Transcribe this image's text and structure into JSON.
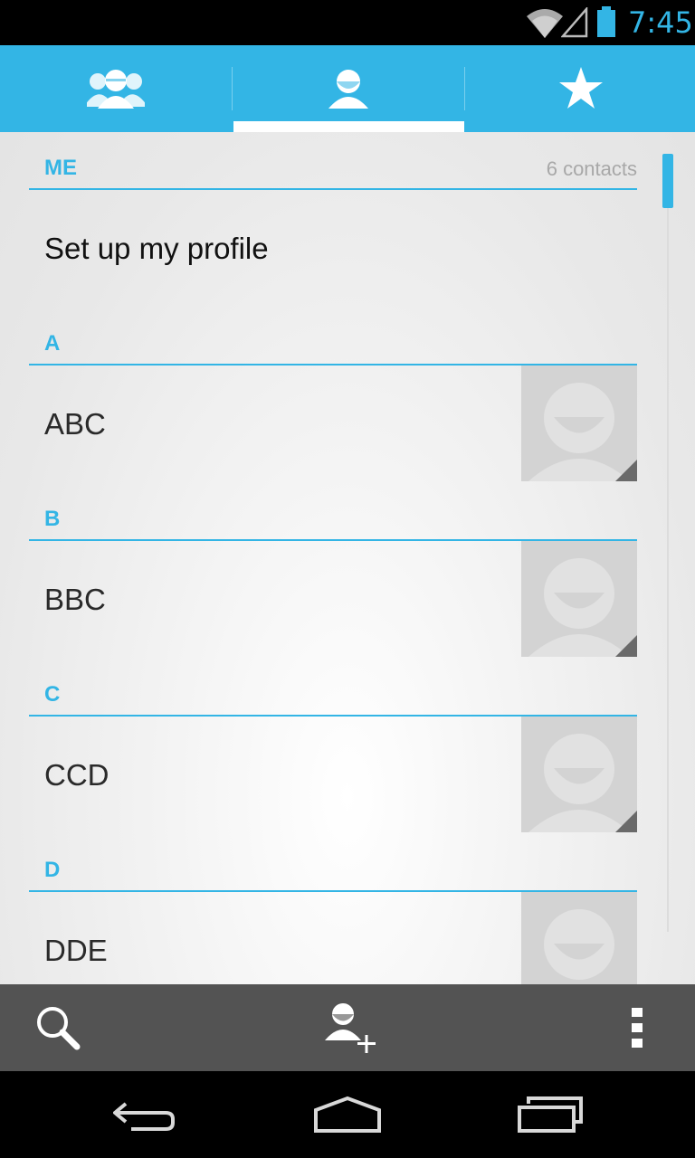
{
  "status_bar": {
    "time": "7:45",
    "icons": [
      "wifi-icon",
      "signal-icon",
      "battery-icon"
    ]
  },
  "tabs": [
    {
      "name": "tab-groups",
      "icon": "groups-icon",
      "selected": false
    },
    {
      "name": "tab-all-contacts",
      "icon": "person-icon",
      "selected": true
    },
    {
      "name": "tab-favorites",
      "icon": "star-icon",
      "selected": false
    }
  ],
  "list": {
    "me_header": "ME",
    "contact_count": "6 contacts",
    "profile_label": "Set up my profile",
    "sections": [
      {
        "letter": "A",
        "contact": "ABC"
      },
      {
        "letter": "B",
        "contact": "BBC"
      },
      {
        "letter": "C",
        "contact": "CCD"
      },
      {
        "letter": "D",
        "contact": "DDE"
      }
    ]
  },
  "action_bar": {
    "icons": [
      "search-icon",
      "add-contact-icon",
      "overflow-menu-icon"
    ]
  },
  "nav_bar": {
    "icons": [
      "back-icon",
      "home-icon",
      "recent-apps-icon"
    ]
  },
  "colors": {
    "accent": "#33b5e5",
    "action_bar": "#535353",
    "placeholder": "#d3d3d3",
    "background": "#e8e8e8"
  }
}
